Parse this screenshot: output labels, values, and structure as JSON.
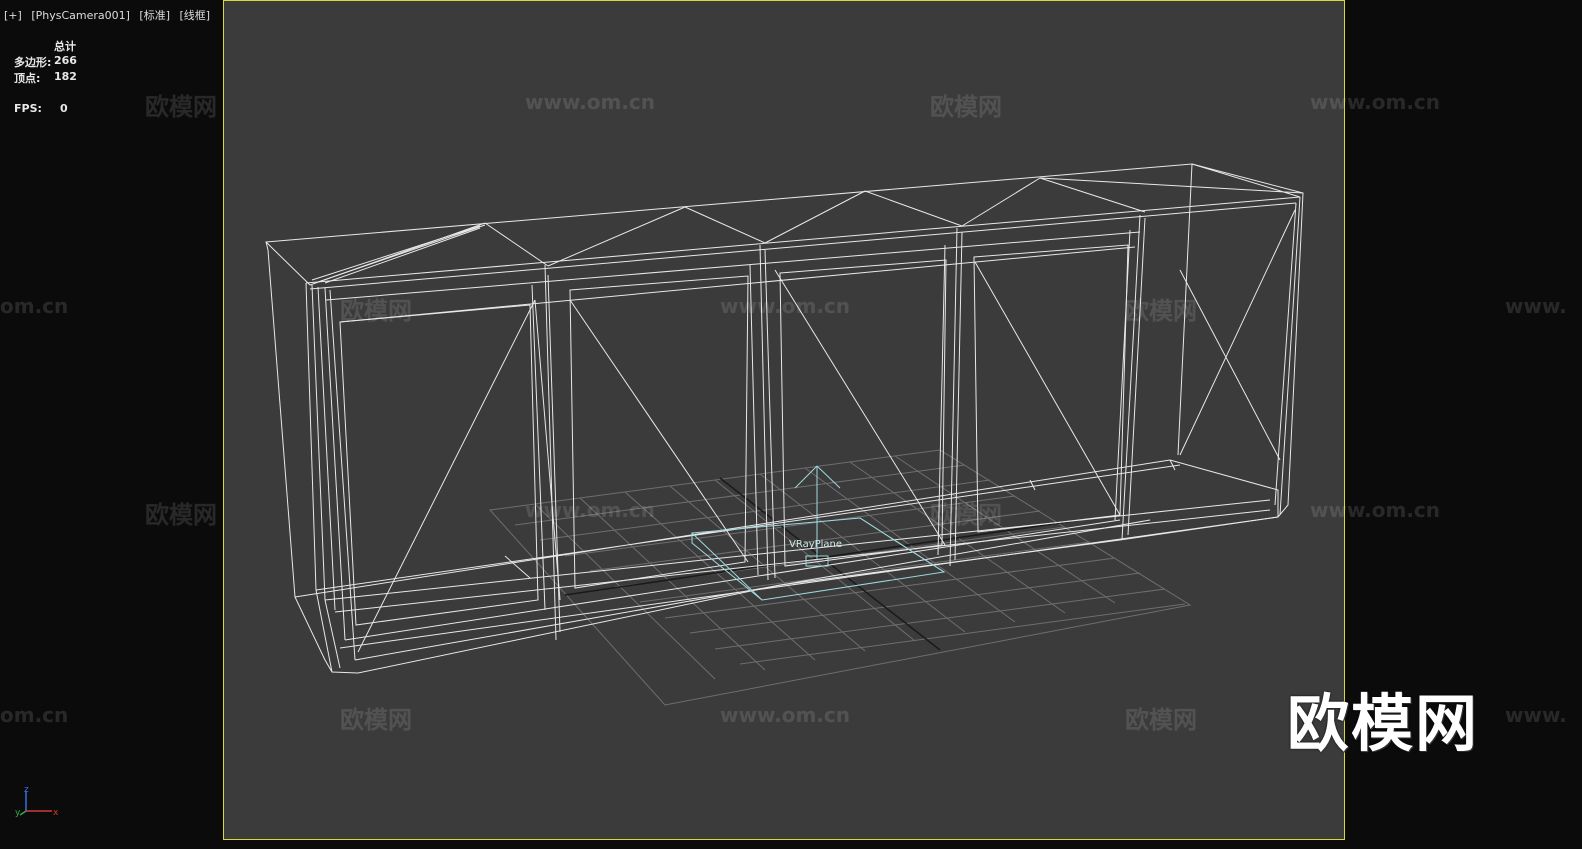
{
  "viewport": {
    "menu_plus": "[+]",
    "camera": "[PhysCamera001]",
    "shading_standard": "[标准]",
    "shading_mode": "[线框]"
  },
  "stats": {
    "header": "总计",
    "polygons_label": "多边形:",
    "polygons_value": "266",
    "vertices_label": "顶点:",
    "vertices_value": "182",
    "fps_label": "FPS:",
    "fps_value": "0"
  },
  "object_label": "VRayPlane",
  "watermark": {
    "brand": "欧模网",
    "url": "www.om.cn",
    "url_partial_left": "om.cn",
    "url_partial_right": "www."
  },
  "axis_labels": {
    "x": "x",
    "y": "y",
    "z": "z"
  },
  "colors": {
    "viewport_bg": "#3b3b3b",
    "frame_border": "#d8d83a",
    "wire": "#e8e8e8",
    "selected_wire": "#9fd8dc",
    "grid": "#6e6e6e"
  }
}
